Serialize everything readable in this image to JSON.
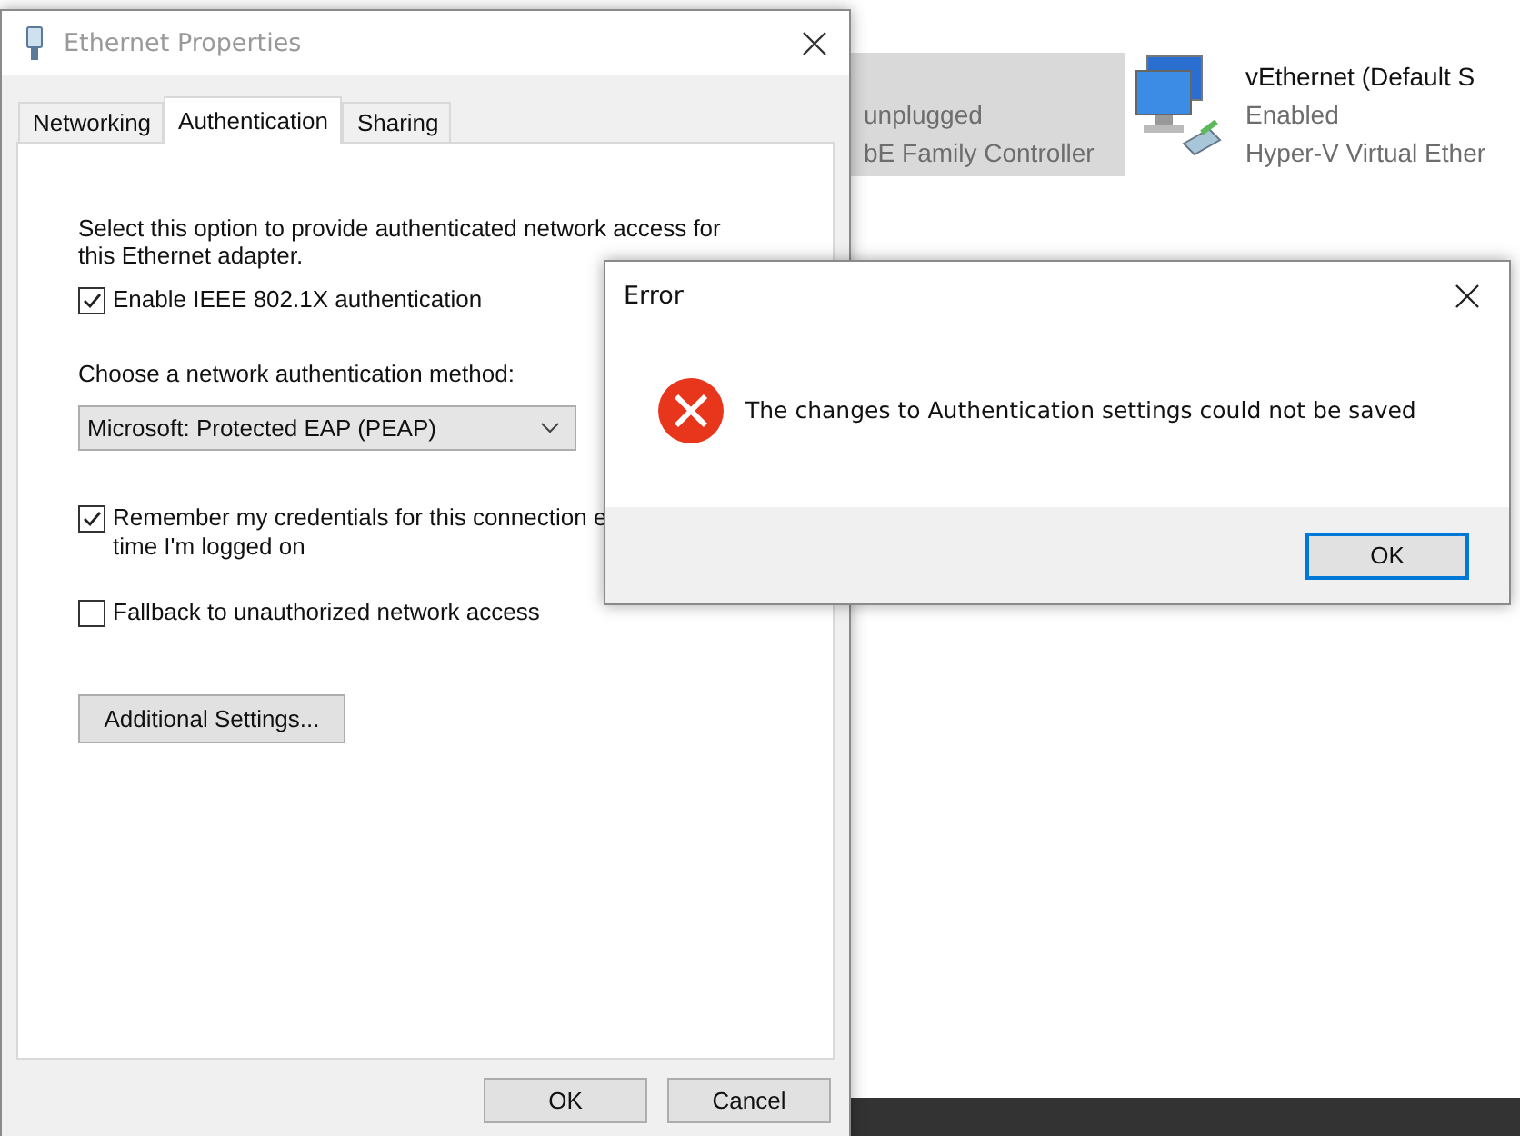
{
  "background_window": {
    "connections": [
      {
        "lines": [
          "unplugged",
          "bE Family Controller"
        ],
        "selected": true,
        "kind": "cut"
      },
      {
        "name": "vEthernet (Default S",
        "lines": [
          "Enabled",
          "Hyper-V Virtual Ether"
        ],
        "selected": false,
        "kind": "full"
      }
    ]
  },
  "properties_dialog": {
    "title": "Ethernet Properties",
    "tabs": [
      {
        "label": "Networking",
        "selected": false
      },
      {
        "label": "Authentication",
        "selected": true
      },
      {
        "label": "Sharing",
        "selected": false
      }
    ],
    "description": "Select this option to provide authenticated network access for this Ethernet adapter.",
    "enable_8021x": {
      "label": "Enable IEEE 802.1X authentication",
      "checked": true
    },
    "method_label": "Choose a network authentication method:",
    "method": "Microsoft: Protected EAP (PEAP)",
    "remember": {
      "label": "Remember my credentials for this connection e",
      "label_continued": "time I'm logged on",
      "checked": true
    },
    "fallback": {
      "label": "Fallback to unauthorized network access",
      "checked": false
    },
    "additional_button": "Additional Settings...",
    "buttons": [
      "OK",
      "Cancel"
    ]
  },
  "error_dialog": {
    "title": "Error",
    "message": "The changes to Authentication settings could not be saved",
    "button": "OK"
  }
}
